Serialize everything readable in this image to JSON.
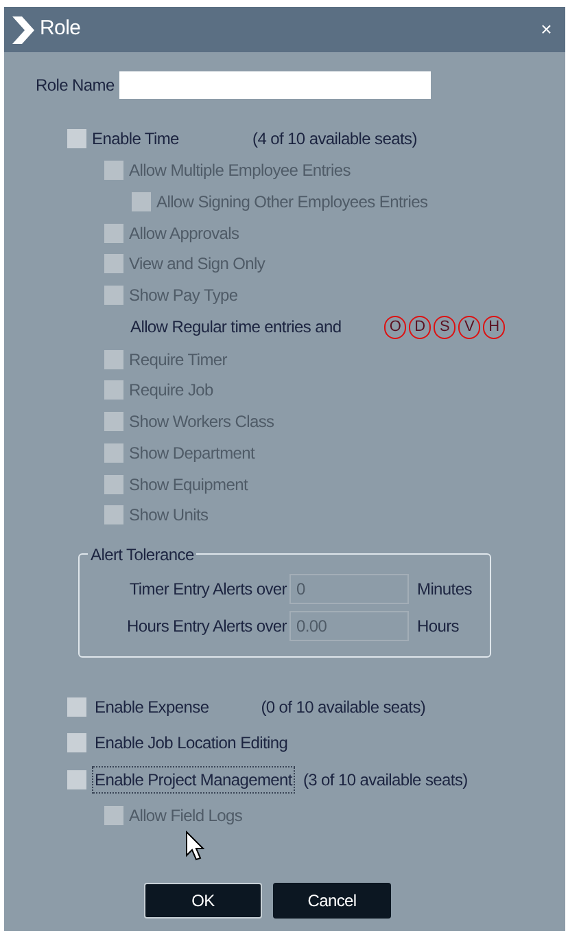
{
  "window": {
    "title": "Role",
    "close": "×"
  },
  "role_name": {
    "label": "Role Name"
  },
  "time": {
    "label": "Enable Time",
    "checked": false,
    "seats": "(4 of 10 available seats)",
    "options": [
      {
        "kind": "checkbox",
        "label": "Allow Multiple Employee Entries",
        "checked": false,
        "disabled": true,
        "children": [
          {
            "kind": "checkbox",
            "label": "Allow Signing Other Employees Entries",
            "checked": false,
            "disabled": true
          }
        ]
      },
      {
        "kind": "checkbox",
        "label": "Allow Approvals",
        "checked": false,
        "disabled": true
      },
      {
        "kind": "checkbox",
        "label": "View and Sign Only",
        "checked": false,
        "disabled": true
      },
      {
        "kind": "checkbox",
        "label": "Show Pay Type",
        "checked": false,
        "disabled": true
      },
      {
        "kind": "paycodes",
        "label": "Allow Regular time entries and",
        "codes": [
          "O",
          "D",
          "S",
          "V",
          "H"
        ]
      },
      {
        "kind": "checkbox",
        "label": "Require Timer",
        "checked": false,
        "disabled": true
      },
      {
        "kind": "checkbox",
        "label": "Require Job",
        "checked": false,
        "disabled": true
      },
      {
        "kind": "checkbox",
        "label": "Show Workers Class",
        "checked": false,
        "disabled": true
      },
      {
        "kind": "checkbox",
        "label": "Show Department",
        "checked": false,
        "disabled": true
      },
      {
        "kind": "checkbox",
        "label": "Show Equipment",
        "checked": false,
        "disabled": true
      },
      {
        "kind": "checkbox",
        "label": "Show Units",
        "checked": false,
        "disabled": true
      }
    ]
  },
  "alert_tolerance": {
    "title": "Alert Tolerance",
    "rows": [
      {
        "label": "Timer Entry Alerts over",
        "value": "0",
        "unit": "Minutes"
      },
      {
        "label": "Hours Entry Alerts over",
        "value": "0.00",
        "unit": "Hours"
      }
    ]
  },
  "modules": [
    {
      "label": "Enable Expense",
      "checked": false,
      "focused": false,
      "seats": "(0 of 10 available seats)"
    },
    {
      "label": "Enable Job Location Editing",
      "checked": false,
      "focused": false
    },
    {
      "label": "Enable Project Management",
      "checked": false,
      "focused": true,
      "seats": "(3 of 10 available seats)",
      "children": [
        {
          "label": "Allow Field Logs",
          "checked": false,
          "disabled": true
        }
      ]
    }
  ],
  "buttons": [
    "OK",
    "Cancel"
  ]
}
